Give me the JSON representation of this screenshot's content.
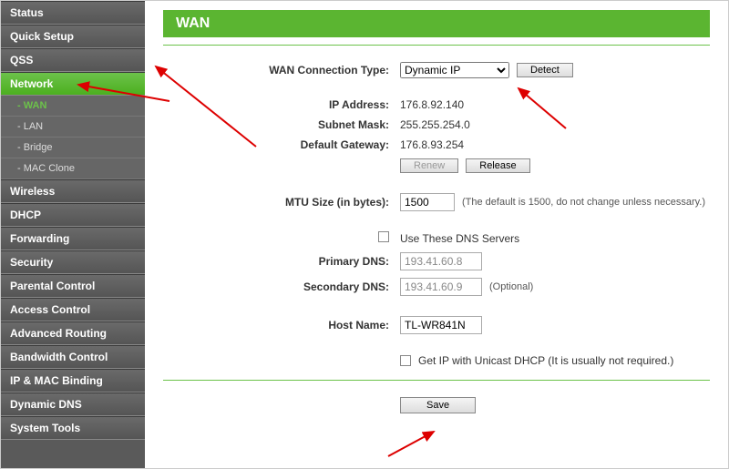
{
  "sidebar": {
    "items": [
      {
        "label": "Status"
      },
      {
        "label": "Quick Setup"
      },
      {
        "label": "QSS"
      },
      {
        "label": "Network",
        "active": true,
        "children": [
          {
            "label": "- WAN",
            "active": true
          },
          {
            "label": "- LAN"
          },
          {
            "label": "- Bridge"
          },
          {
            "label": "- MAC Clone"
          }
        ]
      },
      {
        "label": "Wireless"
      },
      {
        "label": "DHCP"
      },
      {
        "label": "Forwarding"
      },
      {
        "label": "Security"
      },
      {
        "label": "Parental Control"
      },
      {
        "label": "Access Control"
      },
      {
        "label": "Advanced Routing"
      },
      {
        "label": "Bandwidth Control"
      },
      {
        "label": "IP & MAC Binding"
      },
      {
        "label": "Dynamic DNS"
      },
      {
        "label": "System Tools"
      }
    ]
  },
  "page": {
    "title": "WAN",
    "labels": {
      "wan_type": "WAN Connection Type:",
      "ip": "IP Address:",
      "mask": "Subnet Mask:",
      "gateway": "Default Gateway:",
      "mtu": "MTU Size (in bytes):",
      "dns_checkbox": "Use These DNS Servers",
      "primary_dns": "Primary DNS:",
      "secondary_dns": "Secondary DNS:",
      "hostname": "Host Name:",
      "unicast": "Get IP with Unicast DHCP (It is usually not required.)"
    },
    "values": {
      "wan_type": "Dynamic IP",
      "ip": "176.8.92.140",
      "mask": "255.255.254.0",
      "gateway": "176.8.93.254",
      "mtu": "1500",
      "primary_dns": "193.41.60.8",
      "secondary_dns": "193.41.60.9",
      "hostname": "TL-WR841N"
    },
    "buttons": {
      "detect": "Detect",
      "renew": "Renew",
      "release": "Release",
      "save": "Save"
    },
    "notes": {
      "mtu": "(The default is 1500, do not change unless necessary.)",
      "secondary_dns": "(Optional)"
    }
  }
}
